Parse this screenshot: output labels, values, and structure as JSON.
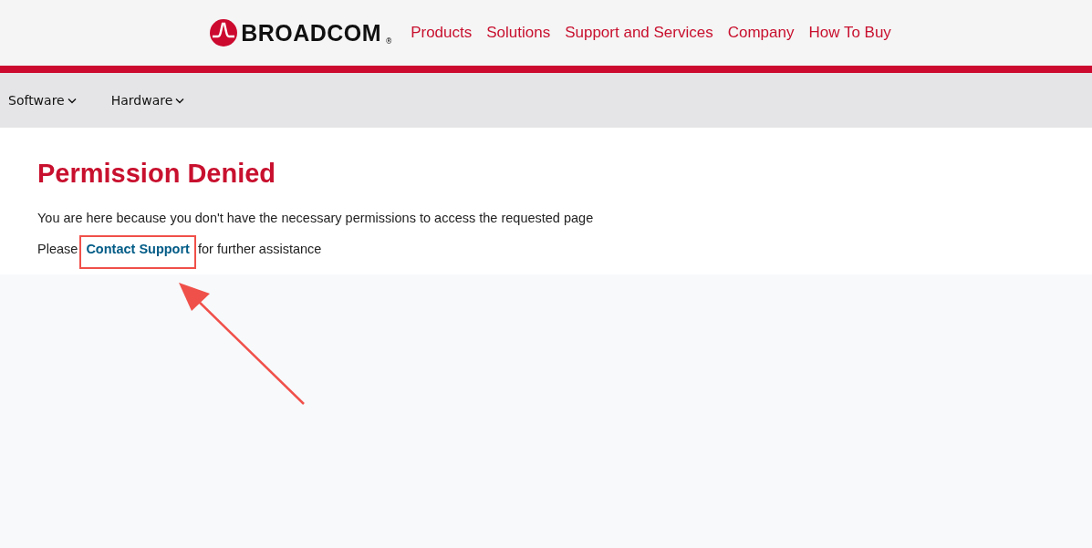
{
  "header": {
    "logo": {
      "text": "BROADCOM",
      "mark": "®"
    },
    "nav": [
      "Products",
      "Solutions",
      "Support and Services",
      "Company",
      "How To Buy"
    ]
  },
  "subnav": [
    {
      "label": "Software",
      "expanded": false
    },
    {
      "label": "Hardware",
      "expanded": false
    }
  ],
  "content": {
    "title": "Permission Denied",
    "message": "You are here because you don't have the necessary permissions to access the requested page",
    "help": {
      "before": "Please",
      "link": "Contact Support",
      "after": "for further assistance"
    }
  },
  "annotation": {
    "highlight": true,
    "arrow": true
  }
}
